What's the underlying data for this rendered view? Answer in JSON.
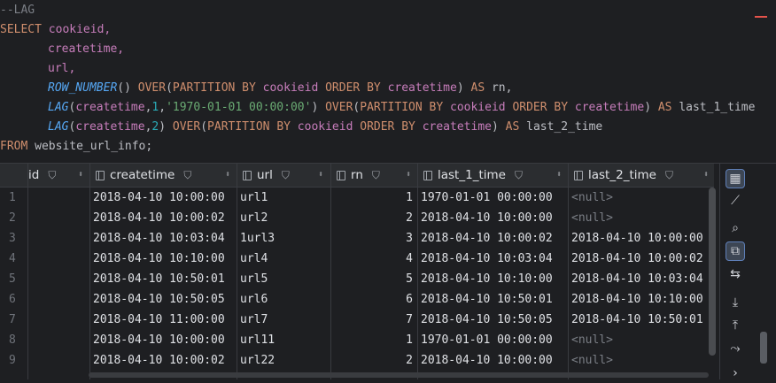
{
  "editor": {
    "comment": "--LAG",
    "line1": {
      "kw": "SELECT",
      "id": "cookieid,"
    },
    "line2": {
      "id": "createtime,"
    },
    "line3": {
      "id": "url,"
    },
    "line4": {
      "fn": "ROW_NUMBER",
      "p1": "() ",
      "kw1": "OVER",
      "p2": "(",
      "kw2": "PARTITION BY",
      "id1": "cookieid",
      "kw3": "ORDER BY",
      "id2": "createtime",
      "p3": ") ",
      "kw4": "AS",
      "alias": "rn,"
    },
    "line5": {
      "fn": "LAG",
      "p1": "(",
      "id1": "createtime",
      "p2": ",",
      "num": "1",
      "p3": ",",
      "str": "'1970-01-01 00:00:00'",
      "p4": ") ",
      "kw1": "OVER",
      "p5": "(",
      "kw2": "PARTITION BY",
      "id2": "cookieid",
      "kw3": "ORDER BY",
      "id3": "createtime",
      "p6": ") ",
      "kw4": "AS",
      "alias": "last_1_time"
    },
    "line6": {
      "fn": "LAG",
      "p1": "(",
      "id1": "createtime",
      "p2": ",",
      "num": "2",
      "p3": ") ",
      "kw1": "OVER",
      "p4": "(",
      "kw2": "PARTITION BY",
      "id2": "cookieid",
      "kw3": "ORDER BY",
      "id3": "createtime",
      "p5": ") ",
      "kw4": "AS",
      "alias": "last_2_time"
    },
    "line7": {
      "kw": "FROM",
      "rest": "website_url_info;"
    }
  },
  "grid": {
    "columns": [
      {
        "label": "id",
        "filter": "⛉",
        "sort": "⬍"
      },
      {
        "label": "createtime",
        "filter": "⛉",
        "sort": "⬍"
      },
      {
        "label": "url",
        "filter": "⛉",
        "sort": "⬍"
      },
      {
        "label": "rn",
        "filter": "⛉",
        "sort": "⬍"
      },
      {
        "label": "last_1_time",
        "filter": "⛉",
        "sort": "⬍"
      },
      {
        "label": "last_2_time",
        "filter": "⛉",
        "sort": "⬍"
      }
    ],
    "rows": [
      {
        "n": "1",
        "createtime": "2018-04-10 10:00:00",
        "url": "url1",
        "rn": "1",
        "last_1_time": "1970-01-01 00:00:00",
        "last_2_time": "<null>"
      },
      {
        "n": "2",
        "createtime": "2018-04-10 10:00:02",
        "url": "url2",
        "rn": "2",
        "last_1_time": "2018-04-10 10:00:00",
        "last_2_time": "<null>"
      },
      {
        "n": "3",
        "createtime": "2018-04-10 10:03:04",
        "url": "1url3",
        "rn": "3",
        "last_1_time": "2018-04-10 10:00:02",
        "last_2_time": "2018-04-10 10:00:00"
      },
      {
        "n": "4",
        "createtime": "2018-04-10 10:10:00",
        "url": "url4",
        "rn": "4",
        "last_1_time": "2018-04-10 10:03:04",
        "last_2_time": "2018-04-10 10:00:02"
      },
      {
        "n": "5",
        "createtime": "2018-04-10 10:50:01",
        "url": "url5",
        "rn": "5",
        "last_1_time": "2018-04-10 10:10:00",
        "last_2_time": "2018-04-10 10:03:04"
      },
      {
        "n": "6",
        "createtime": "2018-04-10 10:50:05",
        "url": "url6",
        "rn": "6",
        "last_1_time": "2018-04-10 10:50:01",
        "last_2_time": "2018-04-10 10:10:00"
      },
      {
        "n": "7",
        "createtime": "2018-04-10 11:00:00",
        "url": "url7",
        "rn": "7",
        "last_1_time": "2018-04-10 10:50:05",
        "last_2_time": "2018-04-10 10:50:01"
      },
      {
        "n": "8",
        "createtime": "2018-04-10 10:00:00",
        "url": "url11",
        "rn": "1",
        "last_1_time": "1970-01-01 00:00:00",
        "last_2_time": "<null>"
      },
      {
        "n": "9",
        "createtime": "2018-04-10 10:00:02",
        "url": "url22",
        "rn": "2",
        "last_1_time": "2018-04-10 10:00:00",
        "last_2_time": "<null>"
      }
    ]
  },
  "toolbar": {
    "icons": [
      "table-view-icon",
      "chart-icon",
      "search-icon",
      "filter-settings-icon",
      "transpose-icon",
      "download-icon",
      "upload-icon",
      "compare-icon",
      "chevron-down-icon"
    ],
    "glyphs": [
      "▦",
      "⟋",
      "⌕",
      "⧉",
      "⇆",
      "⤓",
      "⤒",
      "⤳",
      "›"
    ]
  },
  "colors": {
    "background": "#1e1f22",
    "keyword": "#cf8e6d",
    "identifier": "#c77dbb",
    "function": "#56a8f5",
    "string": "#6aab73",
    "number": "#2aacb8"
  }
}
